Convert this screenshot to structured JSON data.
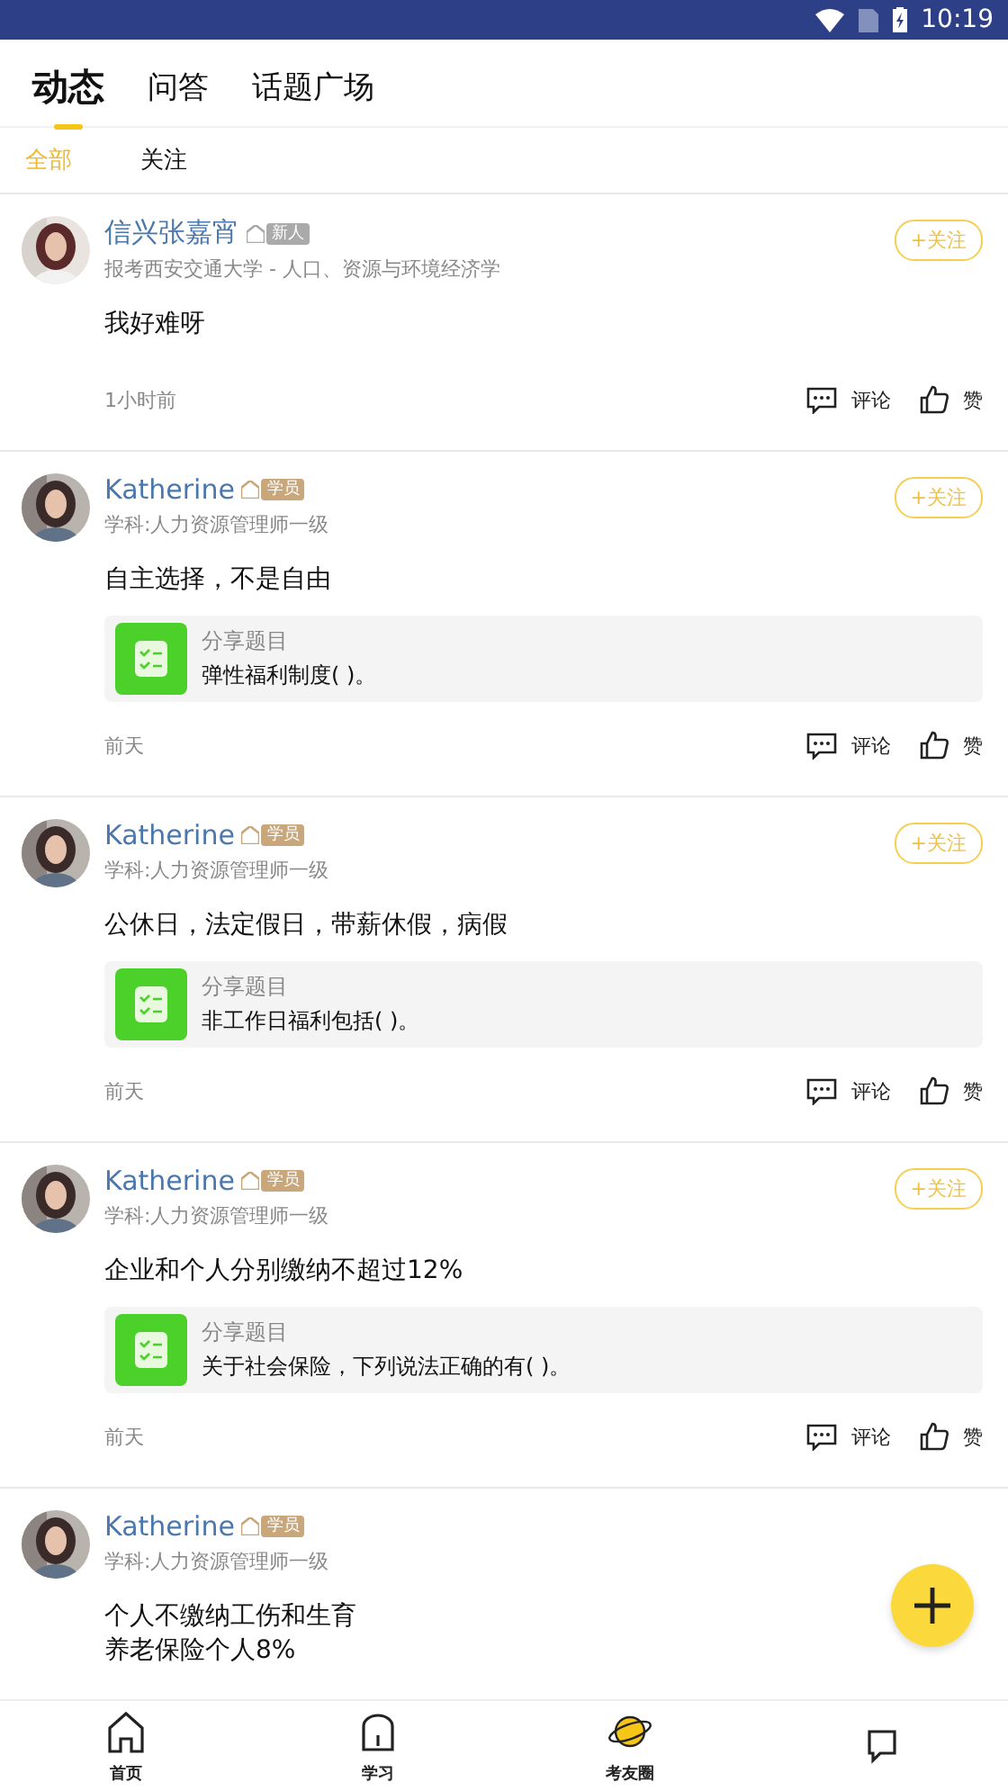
{
  "status_bar": {
    "time": "10:19"
  },
  "tabs": [
    {
      "label": "动态",
      "selected": true
    },
    {
      "label": "问答",
      "selected": false
    },
    {
      "label": "话题广场",
      "selected": false
    }
  ],
  "filters": [
    {
      "label": "全部",
      "selected": true
    },
    {
      "label": "关注",
      "selected": false
    }
  ],
  "posts": [
    {
      "name": "信兴张嘉宵",
      "badge": {
        "kind": "new",
        "label": "新人"
      },
      "subtitle": "报考西安交通大学 - 人口、资源与环境经济学",
      "follow": "+关注",
      "text": [
        "我好难呀"
      ],
      "time": "1小时前",
      "comment": "评论",
      "like": "赞"
    },
    {
      "name": "Katherine",
      "badge": {
        "kind": "student",
        "label": "学员"
      },
      "subtitle": "学科:人力资源管理师一级",
      "follow": "+关注",
      "text": [
        "自主选择，不是自由"
      ],
      "share": {
        "label": "分享题目",
        "question": "弹性福利制度( )。"
      },
      "time": "前天",
      "comment": "评论",
      "like": "赞"
    },
    {
      "name": "Katherine",
      "badge": {
        "kind": "student",
        "label": "学员"
      },
      "subtitle": "学科:人力资源管理师一级",
      "follow": "+关注",
      "text": [
        "公休日，法定假日，带薪休假，病假"
      ],
      "share": {
        "label": "分享题目",
        "question": "非工作日福利包括( )。"
      },
      "time": "前天",
      "comment": "评论",
      "like": "赞"
    },
    {
      "name": "Katherine",
      "badge": {
        "kind": "student",
        "label": "学员"
      },
      "subtitle": "学科:人力资源管理师一级",
      "follow": "+关注",
      "text": [
        "企业和个人分别缴纳不超过12%"
      ],
      "share": {
        "label": "分享题目",
        "question": "关于社会保险，下列说法正确的有( )。"
      },
      "time": "前天",
      "comment": "评论",
      "like": "赞"
    },
    {
      "name": "Katherine",
      "badge": {
        "kind": "student",
        "label": "学员"
      },
      "subtitle": "学科:人力资源管理师一级",
      "text": [
        "个人不缴纳工伤和生育",
        "养老保险个人8%"
      ]
    }
  ],
  "nav": [
    {
      "label": "首页",
      "kind": "home"
    },
    {
      "label": "学习",
      "kind": "study"
    },
    {
      "label": "考友圈",
      "kind": "planet"
    },
    {
      "kind": "chat"
    }
  ]
}
